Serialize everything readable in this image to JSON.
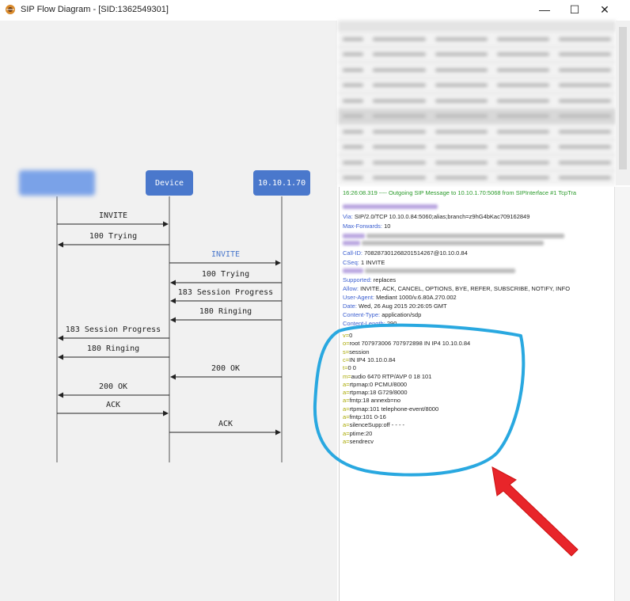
{
  "window": {
    "title": "SIP Flow Diagram - [SID:1362549301]",
    "minimize_glyph": "—",
    "maximize_glyph": "☐",
    "close_glyph": "✕"
  },
  "entities": [
    "",
    "Device",
    "10.10.1.70"
  ],
  "messages": [
    {
      "label": "INVITE",
      "highlight": false
    },
    {
      "label": "100 Trying",
      "highlight": false
    },
    {
      "label": "INVITE",
      "highlight": true
    },
    {
      "label": "100 Trying",
      "highlight": false
    },
    {
      "label": "183 Session Progress",
      "highlight": false
    },
    {
      "label": "180 Ringing",
      "highlight": false
    },
    {
      "label": "183 Session Progress",
      "highlight": false
    },
    {
      "label": "180 Ringing",
      "highlight": false
    },
    {
      "label": "200 OK",
      "highlight": false
    },
    {
      "label": "200 OK",
      "highlight": false
    },
    {
      "label": "ACK",
      "highlight": false
    },
    {
      "label": "ACK",
      "highlight": false
    }
  ],
  "sip_message": {
    "header_line": "16:26:08.319  ---- Outgoing SIP Message to 10.10.1.70:5068 from SIPInterface #1 TcpTra",
    "via": {
      "key": "Via:",
      "value": "SIP/2.0/TCP 10.10.0.84:5060;alias;branch=z9hG4bKac709162849"
    },
    "max_forwards": {
      "key": "Max-Forwards:",
      "value": "10"
    },
    "call_id": {
      "key": "Call-ID:",
      "value": "708287301268201514267@10.10.0.84"
    },
    "cseq": {
      "key": "CSeq:",
      "value": "1 INVITE"
    },
    "supported": {
      "key": "Supported:",
      "value": "replaces"
    },
    "allow": {
      "key": "Allow:",
      "value": "INVITE, ACK, CANCEL, OPTIONS, BYE, REFER, SUBSCRIBE, NOTIFY, INFO"
    },
    "user_agent": {
      "key": "User-Agent:",
      "value": "Mediant 1000/v.6.80A.270.002"
    },
    "date": {
      "key": "Date:",
      "value": "Wed, 26 Aug 2015 20:26:05 GMT"
    },
    "content_type": {
      "key": "Content-Type:",
      "value": "application/sdp"
    },
    "content_length": {
      "key": "Content-Length:",
      "value": "290"
    },
    "sdp": [
      {
        "k": "v=",
        "v": "0"
      },
      {
        "k": "o=",
        "v": "root 707973006 707972898 IN IP4 10.10.0.84"
      },
      {
        "k": "s=",
        "v": "session"
      },
      {
        "k": "c=",
        "v": "IN IP4 10.10.0.84"
      },
      {
        "k": "t=",
        "v": "0 0"
      },
      {
        "k": "m=",
        "v": "audio 6470 RTP/AVP 0 18 101"
      },
      {
        "k": "a=",
        "v": "rtpmap:0 PCMU/8000"
      },
      {
        "k": "a=",
        "v": "rtpmap:18 G729/8000"
      },
      {
        "k": "a=",
        "v": "fmtp:18 annexb=no"
      },
      {
        "k": "a=",
        "v": "rtpmap:101 telephone-event/8000"
      },
      {
        "k": "a=",
        "v": "fmtp:101 0-16"
      },
      {
        "k": "a=",
        "v": "silenceSupp:off - - - -"
      },
      {
        "k": "a=",
        "v": "ptime:20"
      },
      {
        "k": "a=",
        "v": "sendrecv"
      }
    ]
  },
  "colors": {
    "entity_fill": "#4a78cc",
    "annotation_circle": "#29a8e0",
    "annotation_arrow": "#e8252a",
    "header_key": "#3c5fd0",
    "sdp_key": "#a8a800",
    "log_green": "#2a9a2a"
  },
  "icons": {
    "app": "sip-flow-app-icon",
    "minimize": "minimize-icon",
    "maximize": "maximize-icon",
    "close": "close-icon"
  }
}
